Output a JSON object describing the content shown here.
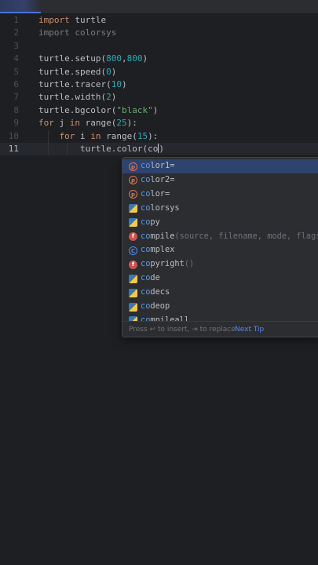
{
  "editor": {
    "lines": [
      {
        "num": "1",
        "segments": [
          {
            "t": "import",
            "c": "kw"
          },
          {
            "t": " turtle",
            "c": ""
          }
        ]
      },
      {
        "num": "2",
        "segments": [
          {
            "t": "import colorsys",
            "c": "gray"
          }
        ]
      },
      {
        "num": "3",
        "segments": []
      },
      {
        "num": "4",
        "segments": [
          {
            "t": "turtle.setup(",
            "c": ""
          },
          {
            "t": "800",
            "c": "num"
          },
          {
            "t": ",",
            "c": ""
          },
          {
            "t": "800",
            "c": "num"
          },
          {
            "t": ")",
            "c": ""
          }
        ]
      },
      {
        "num": "5",
        "segments": [
          {
            "t": "turtle.speed(",
            "c": ""
          },
          {
            "t": "0",
            "c": "num"
          },
          {
            "t": ")",
            "c": ""
          }
        ]
      },
      {
        "num": "6",
        "segments": [
          {
            "t": "turtle.tracer(",
            "c": ""
          },
          {
            "t": "10",
            "c": "num"
          },
          {
            "t": ")",
            "c": ""
          }
        ]
      },
      {
        "num": "7",
        "segments": [
          {
            "t": "turtle.width(",
            "c": ""
          },
          {
            "t": "2",
            "c": "num"
          },
          {
            "t": ")",
            "c": ""
          }
        ]
      },
      {
        "num": "8",
        "segments": [
          {
            "t": "turtle.bgcolor(",
            "c": ""
          },
          {
            "t": "\"black\"",
            "c": "str"
          },
          {
            "t": ")",
            "c": ""
          }
        ]
      },
      {
        "num": "9",
        "segments": [
          {
            "t": "for",
            "c": "kw"
          },
          {
            "t": " j ",
            "c": ""
          },
          {
            "t": "in",
            "c": "kw"
          },
          {
            "t": " range(",
            "c": ""
          },
          {
            "t": "25",
            "c": "num"
          },
          {
            "t": "):",
            "c": ""
          }
        ]
      },
      {
        "num": "10",
        "segments": [
          {
            "t": "    ",
            "c": ""
          },
          {
            "t": "for",
            "c": "kw"
          },
          {
            "t": " i ",
            "c": ""
          },
          {
            "t": "in",
            "c": "kw"
          },
          {
            "t": " range(",
            "c": ""
          },
          {
            "t": "15",
            "c": "num"
          },
          {
            "t": "):",
            "c": ""
          }
        ]
      },
      {
        "num": "11",
        "current": true,
        "segments": [
          {
            "t": "        turtle.color(co",
            "c": ""
          },
          {
            "t": ")",
            "c": ""
          }
        ]
      }
    ]
  },
  "completion": {
    "items": [
      {
        "icon": "param",
        "glyph": "p",
        "match": "co",
        "rest": "lor1=",
        "tail": "",
        "selected": true
      },
      {
        "icon": "param",
        "glyph": "p",
        "match": "co",
        "rest": "lor2=",
        "tail": ""
      },
      {
        "icon": "param",
        "glyph": "p",
        "match": "co",
        "rest": "lor=",
        "tail": ""
      },
      {
        "icon": "mod",
        "glyph": "",
        "match": "co",
        "rest": "lorsys",
        "tail": ""
      },
      {
        "icon": "mod",
        "glyph": "",
        "match": "co",
        "rest": "py",
        "tail": ""
      },
      {
        "icon": "func",
        "glyph": "f",
        "match": "co",
        "rest": "mpile",
        "tail": "(source, filename, mode, flags, d"
      },
      {
        "icon": "cls",
        "glyph": "C",
        "match": "co",
        "rest": "mplex",
        "tail": ""
      },
      {
        "icon": "func",
        "glyph": "f",
        "match": "co",
        "rest": "pyright",
        "tail": "()"
      },
      {
        "icon": "mod",
        "glyph": "",
        "match": "co",
        "rest": "de",
        "tail": ""
      },
      {
        "icon": "mod",
        "glyph": "",
        "match": "co",
        "rest": "decs",
        "tail": ""
      },
      {
        "icon": "mod",
        "glyph": "",
        "match": "co",
        "rest": "deop",
        "tail": ""
      },
      {
        "icon": "mod",
        "glyph": "",
        "match": "co",
        "rest": "mpileall",
        "tail": ""
      }
    ],
    "hint": "Press ↩ to insert, ⇥ to replace",
    "next_tip": "Next Tip"
  }
}
